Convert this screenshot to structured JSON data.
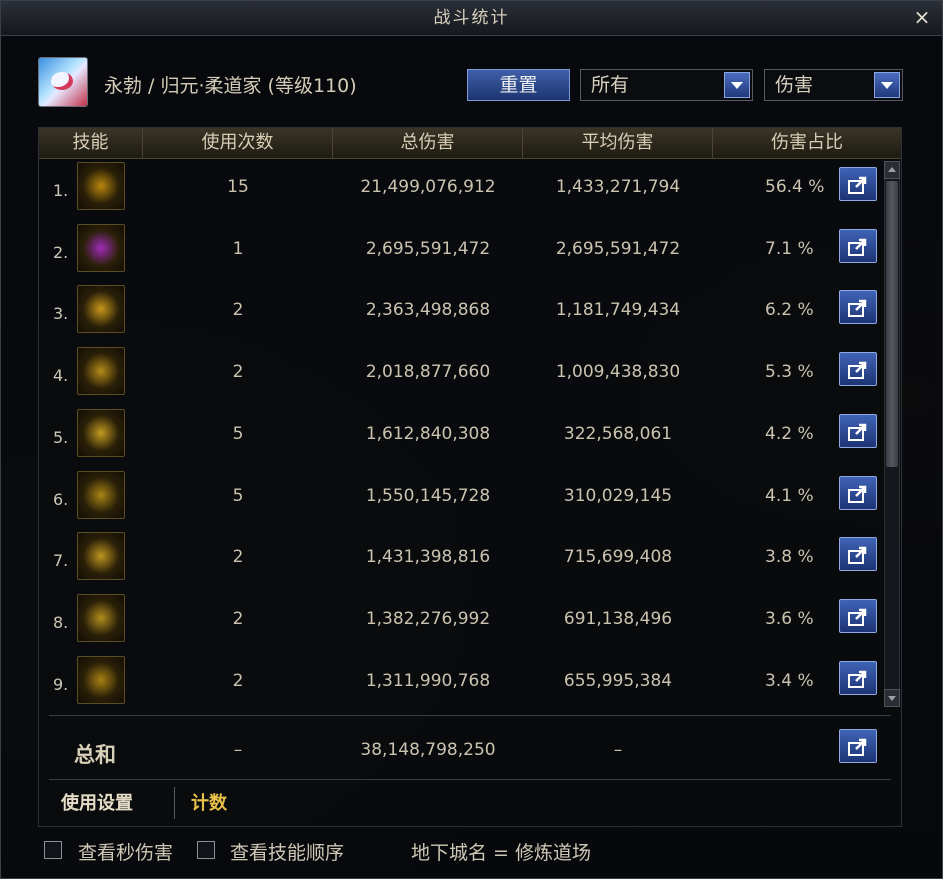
{
  "window": {
    "title": "战斗统计"
  },
  "character": {
    "name": "永勃 / 归元·柔道家 (等级110)"
  },
  "controls": {
    "reset_label": "重置",
    "filter_value": "所有",
    "type_value": "伤害"
  },
  "table": {
    "headers": [
      "技能",
      "使用次数",
      "总伤害",
      "平均伤害",
      "伤害占比"
    ],
    "rows": [
      {
        "rank": "1.",
        "uses": "15",
        "total": "21,499,076,912",
        "avg": "1,433,271,794",
        "pct": "56.4 %",
        "icon": "vortex-skill-icon",
        "color": "#b8860b"
      },
      {
        "rank": "2.",
        "uses": "1",
        "total": "2,695,591,472",
        "avg": "2,695,591,472",
        "pct": "7.1 %",
        "icon": "awakening-portrait-icon",
        "color": "#a02ab8"
      },
      {
        "rank": "3.",
        "uses": "2",
        "total": "2,363,498,868",
        "avg": "1,181,749,434",
        "pct": "6.2 %",
        "icon": "spark-burst-icon",
        "color": "#c9981a"
      },
      {
        "rank": "4.",
        "uses": "2",
        "total": "2,018,877,660",
        "avg": "1,009,438,830",
        "pct": "5.3 %",
        "icon": "rush-strike-icon",
        "color": "#b58a18"
      },
      {
        "rank": "5.",
        "uses": "5",
        "total": "1,612,840,308",
        "avg": "322,568,061",
        "pct": "4.2 %",
        "icon": "kick-skill-icon",
        "color": "#c39a20"
      },
      {
        "rank": "6.",
        "uses": "5",
        "total": "1,550,145,728",
        "avg": "310,029,145",
        "pct": "4.1 %",
        "icon": "ground-slam-icon",
        "color": "#a88416"
      },
      {
        "rank": "7.",
        "uses": "2",
        "total": "1,431,398,816",
        "avg": "715,699,408",
        "pct": "3.8 %",
        "icon": "throw-skill-icon",
        "color": "#bf9520"
      },
      {
        "rank": "8.",
        "uses": "2",
        "total": "1,382,276,992",
        "avg": "691,138,496",
        "pct": "3.6 %",
        "icon": "uppercut-skill-icon",
        "color": "#b08c1c"
      },
      {
        "rank": "9.",
        "uses": "2",
        "total": "1,311,990,768",
        "avg": "655,995,384",
        "pct": "3.4 %",
        "icon": "grass-wave-icon",
        "color": "#a88014"
      }
    ],
    "totals": {
      "label": "总和",
      "uses": "–",
      "total": "38,148,798,250",
      "avg": "–"
    }
  },
  "tabs": {
    "settings": "使用设置",
    "count": "计数"
  },
  "footer": {
    "check_dps": "查看秒伤害",
    "check_order": "查看技能顺序",
    "dungeon": "地下城名 = 修炼道场"
  }
}
